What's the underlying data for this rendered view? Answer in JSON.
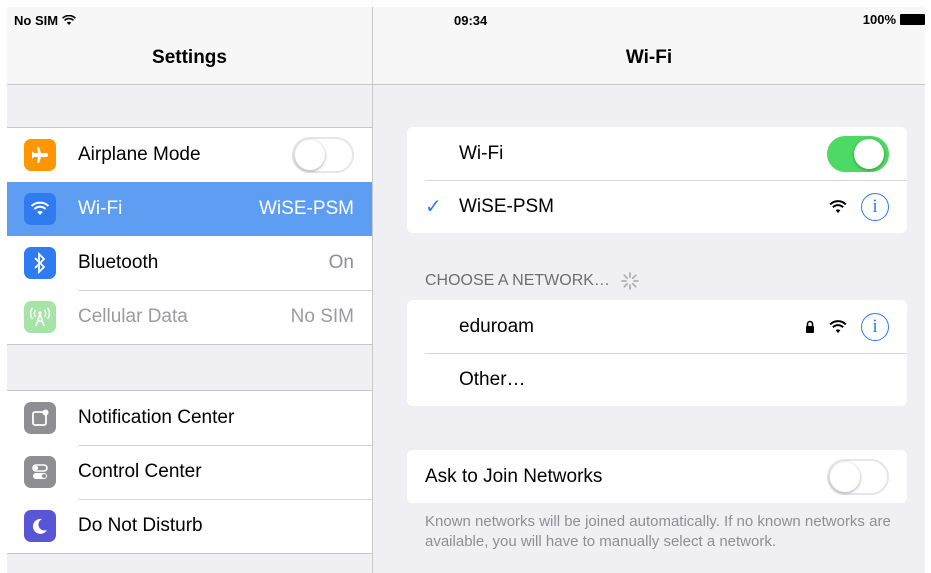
{
  "status_bar": {
    "carrier": "No SIM",
    "time": "09:34",
    "battery": "100%"
  },
  "settings_pane": {
    "title": "Settings",
    "group1": [
      {
        "label": "Airplane Mode",
        "value": "",
        "icon": "airplane-icon",
        "icon_color": "#ff9500",
        "toggle": false
      },
      {
        "label": "Wi-Fi",
        "value": "WiSE-PSM",
        "icon": "wifi-icon",
        "icon_color": "#2f7bef",
        "selected": true
      },
      {
        "label": "Bluetooth",
        "value": "On",
        "icon": "bluetooth-icon",
        "icon_color": "#2f7bef"
      },
      {
        "label": "Cellular Data",
        "value": "No SIM",
        "icon": "cellular-icon",
        "icon_color": "#a6e3a6",
        "disabled": true
      }
    ],
    "group2": [
      {
        "label": "Notification Center",
        "icon": "notification-center-icon",
        "icon_color": "#8e8e93"
      },
      {
        "label": "Control Center",
        "icon": "control-center-icon",
        "icon_color": "#8e8e93"
      },
      {
        "label": "Do Not Disturb",
        "icon": "moon-icon",
        "icon_color": "#5856d6"
      }
    ]
  },
  "wifi_pane": {
    "title": "Wi-Fi",
    "wifi_toggle": {
      "label": "Wi-Fi",
      "on": true
    },
    "connected_network": "WiSE-PSM",
    "choose_header": "CHOOSE A NETWORK…",
    "networks": [
      {
        "name": "eduroam",
        "locked": true
      }
    ],
    "other_label": "Other…",
    "ask_to_join": {
      "label": "Ask to Join Networks",
      "on": false
    },
    "footer_note": "Known networks will be joined automatically. If no known networks are available, you will have to manually select a network."
  },
  "colors": {
    "accent": "#2f7bef",
    "selected_row": "#5d9ef2",
    "toggle_on": "#4cd964"
  }
}
